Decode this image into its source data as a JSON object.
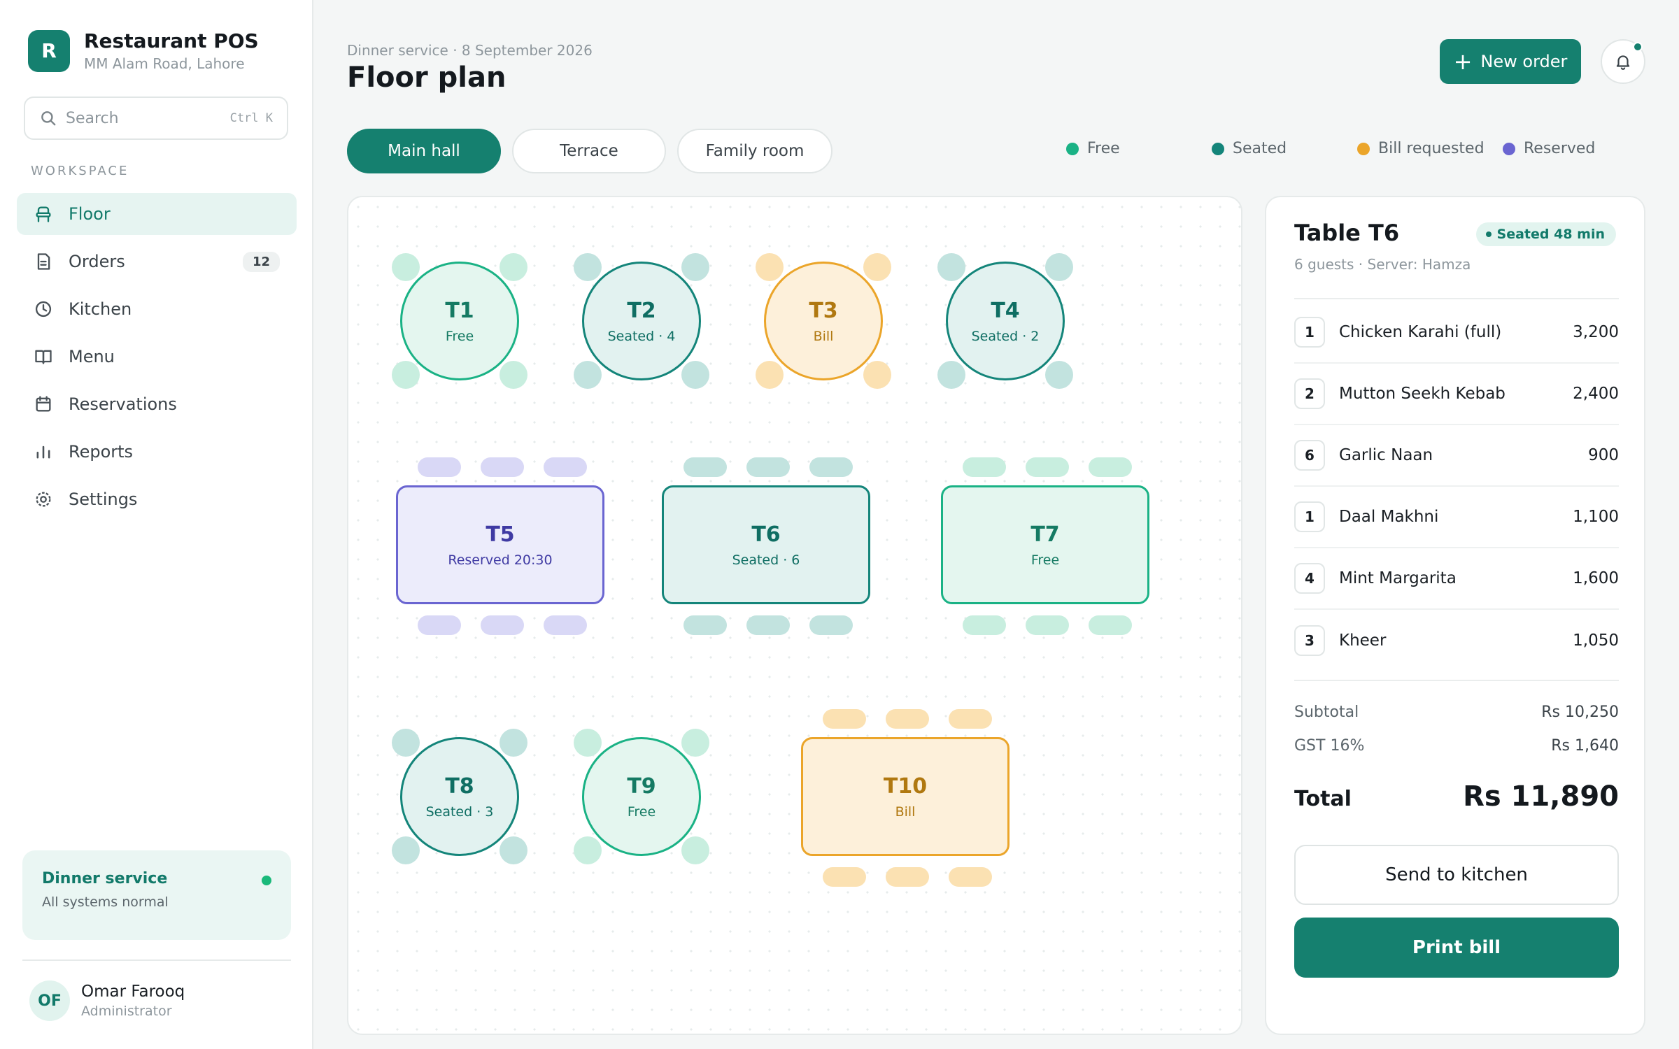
{
  "app": {
    "logo_letter": "R",
    "title": "Restaurant POS",
    "subtitle": "MM Alam Road, Lahore"
  },
  "search": {
    "placeholder": "Search",
    "shortcut": "Ctrl K"
  },
  "sidebar": {
    "section_label": "WORKSPACE",
    "items": [
      {
        "label": "Floor",
        "icon": "chair-icon",
        "active": true
      },
      {
        "label": "Orders",
        "icon": "receipt-icon",
        "badge": "12"
      },
      {
        "label": "Kitchen",
        "icon": "clock-icon"
      },
      {
        "label": "Menu",
        "icon": "book-icon"
      },
      {
        "label": "Reservations",
        "icon": "calendar-icon"
      },
      {
        "label": "Reports",
        "icon": "bar-chart-icon"
      },
      {
        "label": "Settings",
        "icon": "gear-icon"
      }
    ],
    "status": {
      "title": "Dinner service",
      "subtitle": "All systems normal",
      "color": "#1ab97a"
    },
    "user": {
      "initials": "OF",
      "name": "Omar Farooq",
      "role": "Administrator"
    }
  },
  "header": {
    "eyebrow": "Dinner service · 8 September 2026",
    "title": "Floor plan",
    "new_order_label": "New order"
  },
  "tabs": [
    {
      "label": "Main hall",
      "active": true
    },
    {
      "label": "Terrace"
    },
    {
      "label": "Family room"
    }
  ],
  "legend": [
    {
      "label": "Free",
      "color": "#1ab285"
    },
    {
      "label": "Seated",
      "color": "#14857a"
    },
    {
      "label": "Bill requested",
      "color": "#eba52a"
    },
    {
      "label": "Reserved",
      "color": "#6a65d1"
    }
  ],
  "tables": [
    {
      "id": "t1",
      "name": "T1",
      "status": "Free",
      "state": "free",
      "shape": "round"
    },
    {
      "id": "t2",
      "name": "T2",
      "status": "Seated · 4",
      "state": "seated",
      "shape": "round"
    },
    {
      "id": "t3",
      "name": "T3",
      "status": "Bill",
      "state": "bill",
      "shape": "round"
    },
    {
      "id": "t4",
      "name": "T4",
      "status": "Seated · 2",
      "state": "seated",
      "shape": "round"
    },
    {
      "id": "t5",
      "name": "T5",
      "status": "Reserved 20:30",
      "state": "res",
      "shape": "rect"
    },
    {
      "id": "t6",
      "name": "T6",
      "status": "Seated · 6",
      "state": "seated",
      "shape": "rect"
    },
    {
      "id": "t7",
      "name": "T7",
      "status": "Free",
      "state": "free",
      "shape": "rect"
    },
    {
      "id": "t8",
      "name": "T8",
      "status": "Seated · 3",
      "state": "seated",
      "shape": "round"
    },
    {
      "id": "t9",
      "name": "T9",
      "status": "Free",
      "state": "free",
      "shape": "round"
    },
    {
      "id": "t10",
      "name": "T10",
      "status": "Bill",
      "state": "bill",
      "shape": "rect"
    }
  ],
  "order": {
    "title": "Table T6",
    "badge": "Seated 48 min",
    "subtitle": "6 guests · Server: Hamza",
    "items": [
      {
        "qty": "1",
        "name": "Chicken Karahi (full)",
        "price": "3,200"
      },
      {
        "qty": "2",
        "name": "Mutton Seekh Kebab",
        "price": "2,400"
      },
      {
        "qty": "6",
        "name": "Garlic Naan",
        "price": "900"
      },
      {
        "qty": "1",
        "name": "Daal Makhni",
        "price": "1,100"
      },
      {
        "qty": "4",
        "name": "Mint Margarita",
        "price": "1,600"
      },
      {
        "qty": "3",
        "name": "Kheer",
        "price": "1,050"
      }
    ],
    "subtotal_label": "Subtotal",
    "subtotal_value": "Rs 10,250",
    "tax_label": "GST 16%",
    "tax_value": "Rs 1,640",
    "total_label": "Total",
    "total_value": "Rs 11,890",
    "send_label": "Send to kitchen",
    "print_label": "Print bill"
  },
  "colors": {
    "accent": "#15806f",
    "accent_soft": "#e6f4f1"
  }
}
